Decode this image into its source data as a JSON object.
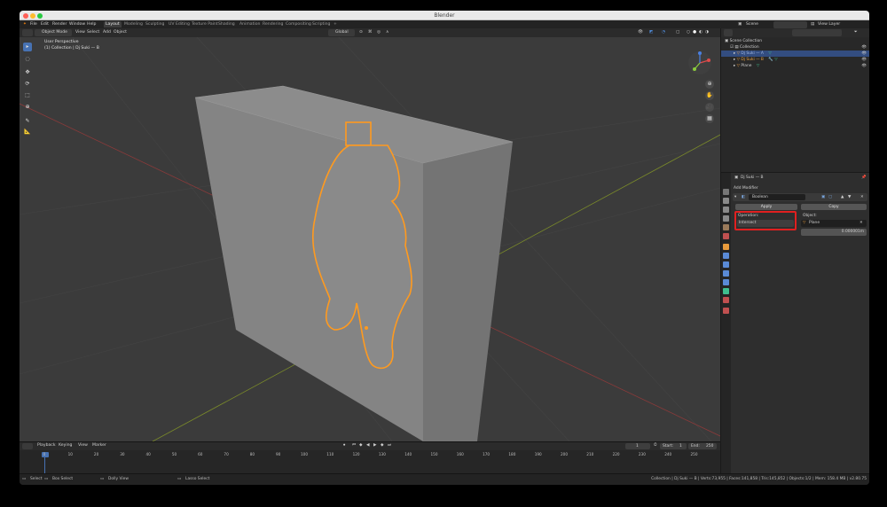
{
  "window": {
    "title": "Blender"
  },
  "menu": [
    "File",
    "Edit",
    "Render",
    "Window",
    "Help"
  ],
  "workspaces": [
    "Layout",
    "Modeling",
    "Sculpting",
    "UV Editing",
    "Texture Paint",
    "Shading",
    "Animation",
    "Rendering",
    "Compositing",
    "Scripting"
  ],
  "workspace_add": "+",
  "scene": {
    "label": "Scene",
    "view_layer": "View Layer"
  },
  "viewport_header": {
    "mode": "Object Mode",
    "menus": [
      "View",
      "Select",
      "Add",
      "Object"
    ],
    "orientation": "Global"
  },
  "viewport": {
    "perspective": "User Perspective",
    "collection_info": "(1) Collection | Dj Suki — B"
  },
  "outliner": {
    "root": "Scene Collection",
    "items": [
      {
        "label": "Collection",
        "level": 1
      },
      {
        "label": "Dj Suki — A",
        "level": 2,
        "selected": true
      },
      {
        "label": "Dj Suki — B",
        "level": 2
      },
      {
        "label": "Plane",
        "level": 2
      }
    ]
  },
  "properties": {
    "object_name": "Dj Suki — B",
    "add_modifier": "Add Modifier",
    "modifier_name": "Boolean",
    "apply_label": "Apply",
    "copy_label": "Copy",
    "operation_label": "Operation:",
    "operation_value": "Intersect",
    "object_label": "Object:",
    "object_value": "Plane",
    "overlap_value": "0.000001m"
  },
  "timeline": {
    "menus": [
      "Playback",
      "Keying",
      "View",
      "Marker"
    ],
    "current_frame": "1",
    "start_label": "Start:",
    "start_value": "1",
    "end_label": "End:",
    "end_value": "250",
    "ticks": [
      "0",
      "10",
      "20",
      "30",
      "40",
      "50",
      "60",
      "70",
      "80",
      "90",
      "100",
      "110",
      "120",
      "130",
      "140",
      "150",
      "160",
      "170",
      "180",
      "190",
      "200",
      "210",
      "220",
      "230",
      "240",
      "250"
    ]
  },
  "statusbar": {
    "left": [
      "Select",
      "Box Select",
      "Dolly View",
      "Lasso Select"
    ],
    "right": "Collection | Dj Suki — B | Verts:73,955 | Faces:141,858 | Tris:145,852 | Objects:1/2 | Mem: 158.4 MB | v2.80.75"
  },
  "colors": {
    "selection_outline": "#ff9a1f",
    "active_highlight": "#4772b3",
    "annotation_red": "#e02020"
  }
}
